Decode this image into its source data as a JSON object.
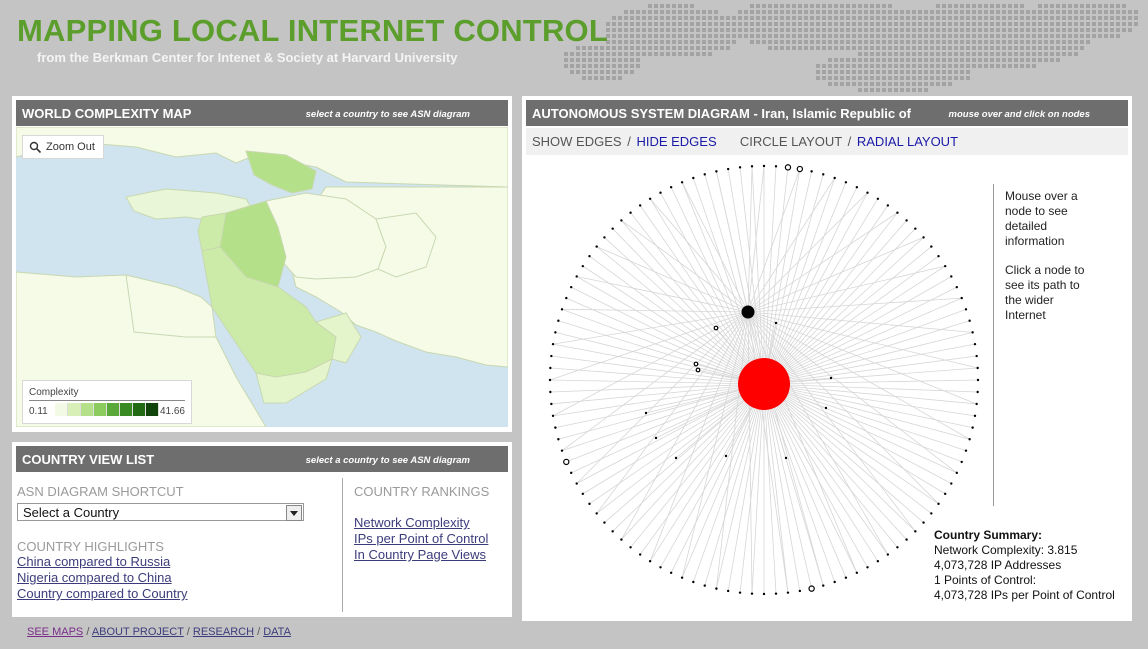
{
  "header": {
    "title": "MAPPING LOCAL INTERNET CONTROL",
    "subtitle": "from the Berkman Center for Intenet & Society at Harvard University"
  },
  "map_panel": {
    "title": "WORLD COMPLEXITY MAP",
    "hint": "select a country to see ASN diagram",
    "zoom_label": "Zoom Out",
    "legend": {
      "title": "Complexity",
      "min": "0.11",
      "max": "41.66"
    },
    "colors": {
      "water": "#cfe4ef",
      "land": "#f6fbe8",
      "low": "#e4f5cc",
      "mid": "#cdeba8",
      "high": "#b5e08a",
      "border": "#c8d8b0"
    }
  },
  "list_panel": {
    "title": "COUNTRY VIEW LIST",
    "hint": "select a country to see ASN diagram",
    "shortcut_label": "ASN DIAGRAM SHORTCUT",
    "select_value": "Select a Country",
    "highlights_label": "COUNTRY HIGHLIGHTS",
    "highlights": [
      "China compared to Russia",
      "Nigeria compared to China",
      "Country compared to Country"
    ],
    "rankings_label": "COUNTRY RANKINGS",
    "rankings": [
      "Network Complexity",
      "IPs per Point of Control",
      "In Country Page Views"
    ]
  },
  "asn_panel": {
    "title": "AUTONOMOUS SYSTEM DIAGRAM - Iran, Islamic Republic of",
    "hint": "mouse over and click on nodes",
    "show_edges": "SHOW EDGES",
    "hide_edges": "HIDE EDGES",
    "circle_layout": "CIRCLE LAYOUT",
    "radial_layout": "RADIAL LAYOUT",
    "separator": "/",
    "info_hover": "Mouse over a node to see detailed information",
    "info_click": "Click a node to see its path to the wider Internet",
    "summary_title": "Country Summary:",
    "summary_lines": [
      "Network Complexity: 3.815",
      "4,073,728 IP Addresses",
      "1 Points of Control:",
      "4,073,728 IPs per Point of Control"
    ],
    "colors": {
      "central_node": "#ff0000",
      "node": "#000000",
      "edge": "#d6d6d6"
    }
  },
  "footer": {
    "links": [
      "SEE MAPS",
      "ABOUT PROJECT",
      "RESEARCH",
      "DATA"
    ],
    "separator": "/"
  }
}
